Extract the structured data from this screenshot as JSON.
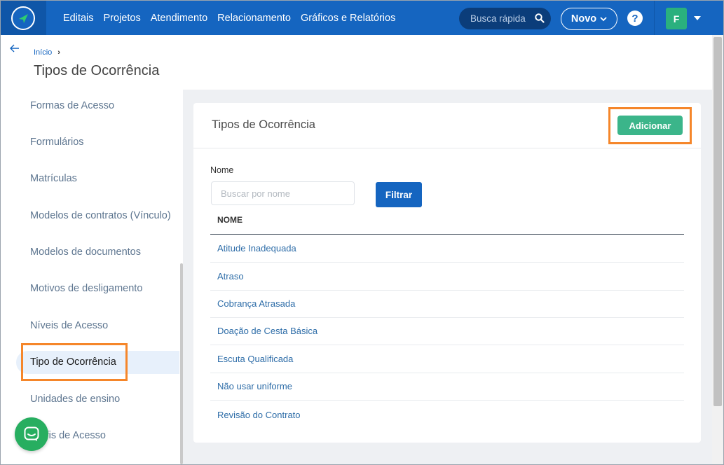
{
  "topbar": {
    "nav": [
      "Editais",
      "Projetos",
      "Atendimento",
      "Relacionamento",
      "Gráficos e Relatórios"
    ],
    "search_placeholder": "Busca rápida",
    "new_label": "Novo",
    "help_label": "?",
    "avatar_initial": "F"
  },
  "header": {
    "breadcrumb_home": "Início",
    "title": "Tipos de Ocorrência"
  },
  "sidebar": {
    "items": [
      "Formas de Acesso",
      "Formulários",
      "Matrículas",
      "Modelos de contratos (Vínculo)",
      "Modelos de documentos",
      "Motivos de desligamento",
      "Níveis de Acesso",
      "Tipo de Ocorrência",
      "Unidades de ensino",
      "Perfis de Acesso"
    ],
    "active_index": 7
  },
  "card": {
    "title": "Tipos de Ocorrência",
    "add_label": "Adicionar",
    "filter_field_label": "Nome",
    "filter_placeholder": "Buscar por nome",
    "filter_button": "Filtrar",
    "column_header": "NOME",
    "rows": [
      "Atitude Inadequada",
      "Atraso",
      "Cobrança Atrasada",
      "Doação de Cesta Básica",
      "Escuta Qualificada",
      "Não usar uniforme",
      "Revisão do Contrato"
    ]
  },
  "colors": {
    "primary": "#1565c0",
    "accent_green": "#3bb58a",
    "highlight_orange": "#f5862a"
  },
  "icons": [
    "logo-icon",
    "search-icon",
    "chevron-down-icon",
    "help-icon",
    "back-arrow-icon",
    "chat-icon"
  ]
}
